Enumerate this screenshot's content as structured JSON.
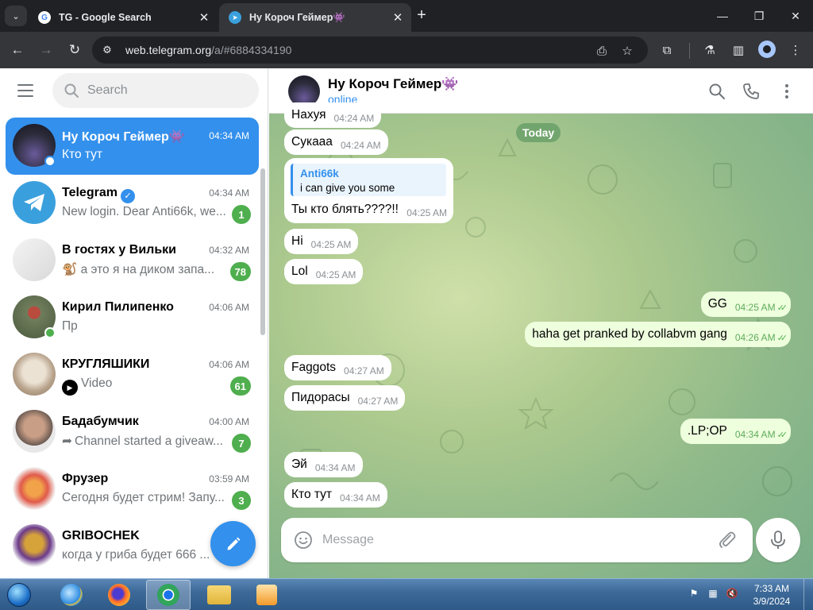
{
  "browser": {
    "tabs": [
      {
        "title": "TG - Google Search",
        "favicon": "G"
      },
      {
        "title": "Ну Короч Геймер👾",
        "favicon": "tg"
      }
    ],
    "url_host": "web.telegram.org",
    "url_path": "/a/#6884334190"
  },
  "sidebar": {
    "search_placeholder": "Search",
    "chats": [
      {
        "name": "Ну Короч Геймер👾",
        "time": "04:34 AM",
        "preview": "Кто тут",
        "badge": "",
        "active": true,
        "avatar_color": "#2b2b3a"
      },
      {
        "name": "Telegram",
        "time": "04:34 AM",
        "preview": "New login. Dear Anti66k, we...",
        "badge": "1",
        "active": false,
        "avatar_color": "#3aa0dd"
      },
      {
        "name": "В гостях у Вильки",
        "time": "04:32 AM",
        "preview": "🐒 а это я на диком запа...",
        "badge": "78",
        "active": false,
        "avatar_color": "#e9e9e9"
      },
      {
        "name": "Кирил Пилипенко",
        "time": "04:06 AM",
        "preview": "Пр",
        "badge": "",
        "active": false,
        "avatar_color": "#7a8b6a"
      },
      {
        "name": "КРУГЛЯШИКИ",
        "time": "04:06 AM",
        "preview": "Video",
        "badge": "61",
        "active": false,
        "avatar_color": "#c9b8a3"
      },
      {
        "name": "Бадабумчик",
        "time": "04:00 AM",
        "preview": "Channel started a giveaw...",
        "badge": "7",
        "active": false,
        "avatar_color": "#8f7a6e"
      },
      {
        "name": "Фрузер",
        "time": "03:59 AM",
        "preview": "Сегодня будет стрим! Запу...",
        "badge": "3",
        "active": false,
        "avatar_color": "#e05a4a"
      },
      {
        "name": "GRIBOCHEK",
        "time": "",
        "preview": "когда у гриба будет 666 ...",
        "badge": "",
        "active": false,
        "avatar_color": "#d6a23a"
      }
    ]
  },
  "chat": {
    "title": "Ну Короч Геймер👾",
    "status": "online",
    "date_label": "Today",
    "top_partial": {
      "text": "Нахуя",
      "time": "04:24 AM"
    },
    "reply": {
      "quote_name": "Anti66k",
      "quote_text": "i can give you some",
      "text": "Ты кто блять????!!",
      "time": "04:25 AM"
    },
    "messages": [
      {
        "text": "Сукааа",
        "time": "04:24 AM",
        "out": false
      },
      {
        "text": "Hi",
        "time": "04:25 AM",
        "out": false
      },
      {
        "text": "Lol",
        "time": "04:25 AM",
        "out": false
      },
      {
        "text": "GG",
        "time": "04:25 AM",
        "out": true
      },
      {
        "text": "haha get pranked by collabvm gang",
        "time": "04:26 AM",
        "out": true
      },
      {
        "text": "Faggots",
        "time": "04:27 AM",
        "out": false
      },
      {
        "text": "Пидорасы",
        "time": "04:27 AM",
        "out": false
      },
      {
        "text": ".LP;OP",
        "time": "04:34 AM",
        "out": true
      },
      {
        "text": "Эй",
        "time": "04:34 AM",
        "out": false
      },
      {
        "text": "Кто тут",
        "time": "04:34 AM",
        "out": false
      }
    ],
    "composer_placeholder": "Message"
  },
  "taskbar": {
    "time": "7:33 AM",
    "date": "3/9/2024"
  },
  "colors": {
    "accent": "#3390ec",
    "badge": "#4fae4e",
    "outgoing": "#eeffde"
  }
}
